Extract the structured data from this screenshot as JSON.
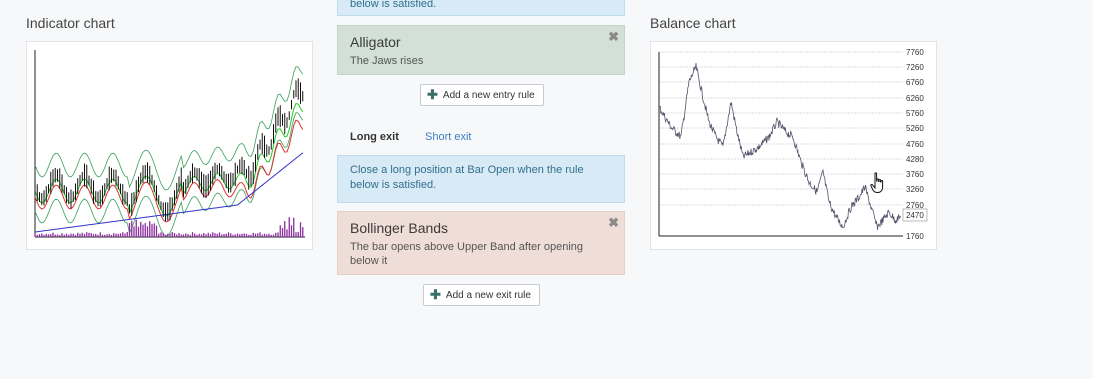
{
  "indicator_chart": {
    "title": "Indicator chart"
  },
  "balance_chart": {
    "title": "Balance chart",
    "y_ticks": [
      "7760",
      "7260",
      "6760",
      "6260",
      "5760",
      "5260",
      "4760",
      "4280",
      "3760",
      "3260",
      "2760",
      "1760"
    ],
    "current_value": "2470"
  },
  "entry": {
    "top_notice": "below is satisfied.",
    "slot": {
      "title": "Alligator",
      "description": "The Jaws rises"
    },
    "add_button": "Add a new entry rule"
  },
  "exit": {
    "tabs": [
      {
        "label": "Long exit"
      },
      {
        "label": "Short exit"
      }
    ],
    "notice": "Close a long position at Bar Open when the rule below is satisfied.",
    "slot": {
      "title": "Bollinger Bands",
      "description": "The bar opens above Upper Band after opening below it"
    },
    "add_button": "Add a new exit rule"
  },
  "icons": {
    "close": "close-icon",
    "plus": "plus-icon",
    "cursor": "hand-cursor-icon"
  },
  "colors": {
    "blue_notice": "#d8eaf5",
    "green_slot": "#d2e0d7",
    "red_slot": "#efded7",
    "link": "#3a7fbf"
  }
}
